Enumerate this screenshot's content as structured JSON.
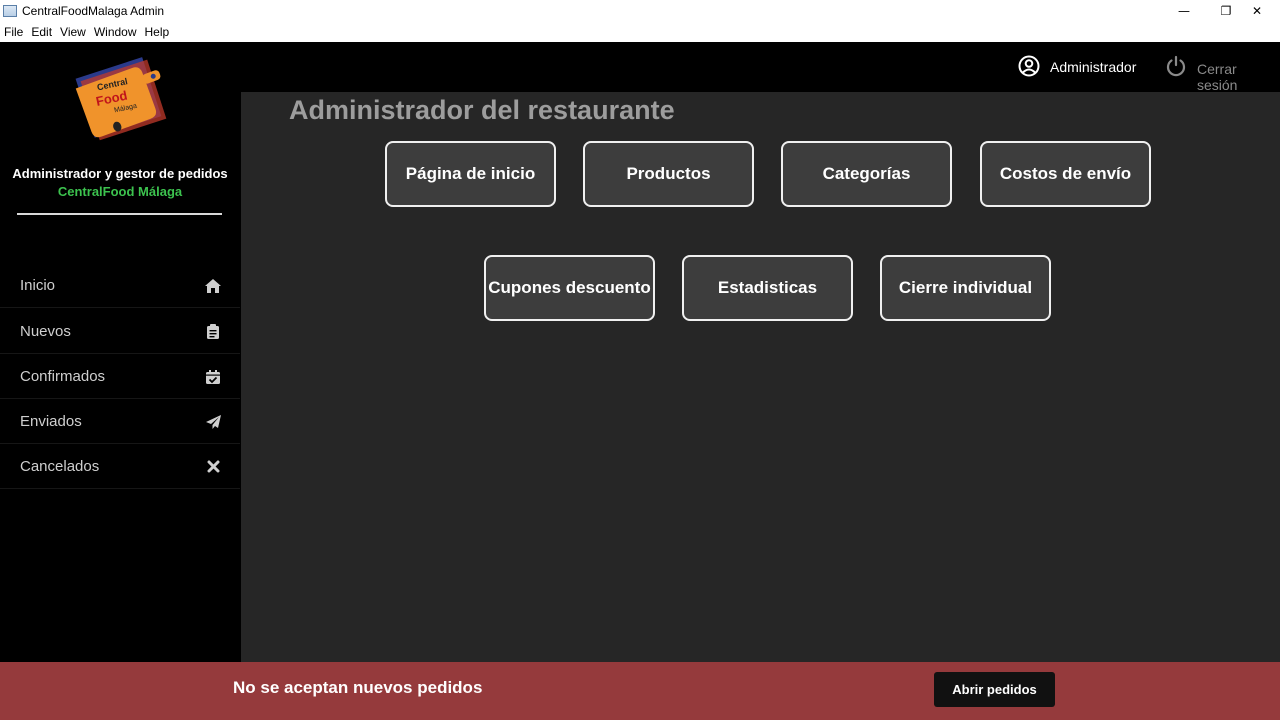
{
  "window": {
    "title": "CentralFoodMalaga Admin",
    "controls": {
      "minimize": "—",
      "maximize": "❐",
      "close": "✕"
    }
  },
  "menubar": {
    "items": [
      {
        "label": "File"
      },
      {
        "label": "Edit"
      },
      {
        "label": "View"
      },
      {
        "label": "Window"
      },
      {
        "label": "Help"
      }
    ]
  },
  "sidebar": {
    "title": "Administrador y gestor de pedidos",
    "subtitle": "CentralFood Málaga",
    "items": [
      {
        "label": "Inicio",
        "icon": "home-icon"
      },
      {
        "label": "Nuevos",
        "icon": "clipboard-icon"
      },
      {
        "label": "Confirmados",
        "icon": "calendar-check-icon"
      },
      {
        "label": "Enviados",
        "icon": "paper-plane-icon"
      },
      {
        "label": "Cancelados",
        "icon": "close-icon"
      }
    ]
  },
  "header": {
    "user_label": "Administrador",
    "logout_label": "Cerrar sesión"
  },
  "main": {
    "title": "Administrador del restaurante",
    "tiles": [
      {
        "label": "Página de inicio"
      },
      {
        "label": "Productos"
      },
      {
        "label": "Categorías"
      },
      {
        "label": "Costos de envío"
      },
      {
        "label": "Cupones descuento"
      },
      {
        "label": "Estadisticas"
      },
      {
        "label": "Cierre individual"
      }
    ]
  },
  "footer": {
    "message": "No se aceptan nuevos pedidos",
    "button_label": "Abrir pedidos"
  },
  "colors": {
    "accent_green": "#3cc24e",
    "banner_red": "#953a3c",
    "main_bg": "#262626"
  }
}
